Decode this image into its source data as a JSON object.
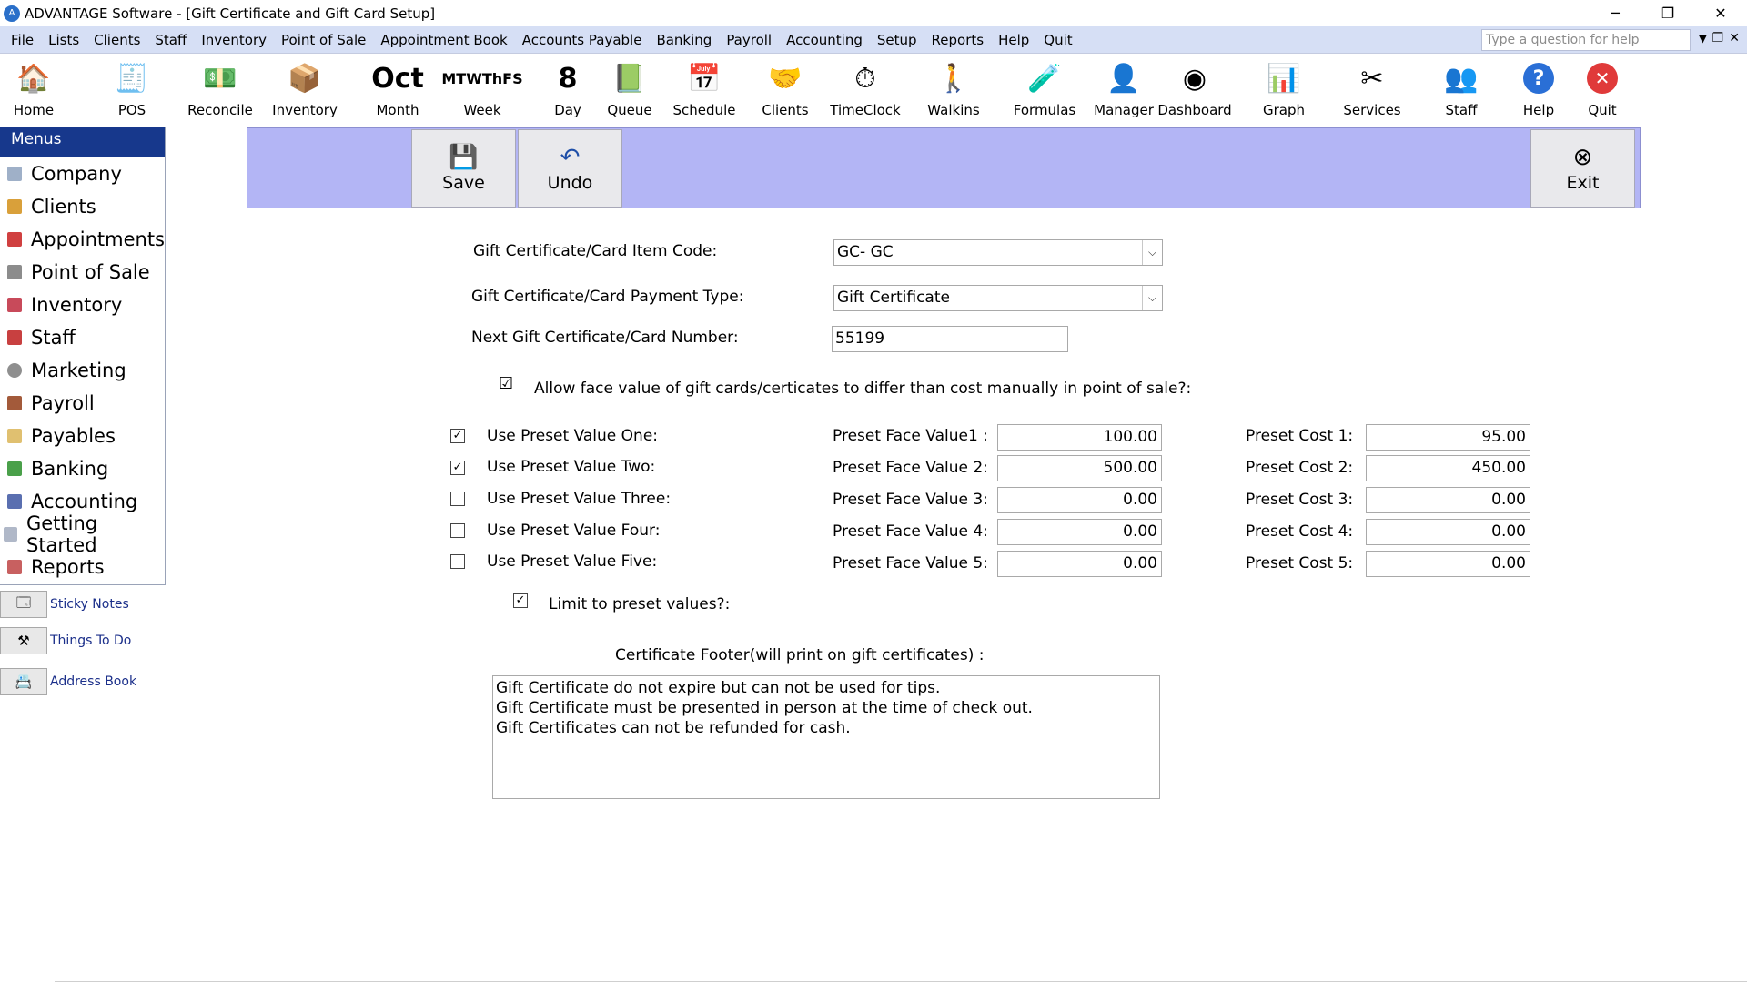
{
  "window": {
    "title": "ADVANTAGE Software - [Gift Certificate and Gift Card Setup]",
    "minimize": "─",
    "restore": "❐",
    "close": "✕"
  },
  "menubar": {
    "items": [
      "File",
      "Lists",
      "Clients",
      "Staff",
      "Inventory",
      "Point of Sale",
      "Appointment Book",
      "Accounts Payable",
      "Banking",
      "Payroll",
      "Accounting",
      "Setup",
      "Reports",
      "Help",
      "Quit"
    ],
    "help_placeholder": "Type a question for help"
  },
  "toolbar": [
    {
      "label": "Home",
      "icon": "house-icon",
      "glyph": "🏠"
    },
    {
      "label": "POS",
      "icon": "cash-register-icon",
      "glyph": "🧾"
    },
    {
      "label": "Reconcile",
      "icon": "money-icon",
      "glyph": "💵"
    },
    {
      "label": "Inventory",
      "icon": "box-icon",
      "glyph": "📦"
    },
    {
      "label": "Month",
      "icon": "calendar-month-icon",
      "glyph": "Oct"
    },
    {
      "label": "Week",
      "icon": "calendar-week-icon",
      "glyph": "MTWThFS"
    },
    {
      "label": "Day",
      "icon": "calendar-day-icon",
      "glyph": "8"
    },
    {
      "label": "Queue",
      "icon": "queue-icon",
      "glyph": "📗"
    },
    {
      "label": "Schedule",
      "icon": "schedule-icon",
      "glyph": "📅"
    },
    {
      "label": "Clients",
      "icon": "handshake-icon",
      "glyph": "🤝"
    },
    {
      "label": "TimeClock",
      "icon": "stopwatch-icon",
      "glyph": "⏱"
    },
    {
      "label": "Walkins",
      "icon": "walkin-icon",
      "glyph": "🚶"
    },
    {
      "label": "Formulas",
      "icon": "formula-icon",
      "glyph": "🧪"
    },
    {
      "label": "Manager",
      "icon": "manager-icon",
      "glyph": "👤"
    },
    {
      "label": "Dashboard",
      "icon": "gauge-icon",
      "glyph": "◉"
    },
    {
      "label": "Graph",
      "icon": "bar-graph-icon",
      "glyph": "📊"
    },
    {
      "label": "Services",
      "icon": "scissors-icon",
      "glyph": "✂"
    },
    {
      "label": "Staff",
      "icon": "staff-icon",
      "glyph": "👥"
    },
    {
      "label": "Help",
      "icon": "help-icon",
      "glyph": "?"
    },
    {
      "label": "Quit",
      "icon": "quit-icon",
      "glyph": "✕"
    }
  ],
  "sidebar": {
    "header": "Menus",
    "items": [
      "Company",
      "Clients",
      "Appointments",
      "Point of Sale",
      "Inventory",
      "Staff",
      "Marketing",
      "Payroll",
      "Payables",
      "Banking",
      "Accounting",
      "Getting Started",
      "Reports"
    ],
    "quick": [
      "Sticky Notes",
      "Things To Do",
      "Address Book"
    ]
  },
  "actions": {
    "save": "Save",
    "undo": "Undo",
    "exit": "Exit"
  },
  "form": {
    "item_code_label": "Gift Certificate/Card  Item Code:",
    "item_code_value": "GC- GC",
    "payment_type_label": "Gift Certificate/Card  Payment Type:",
    "payment_type_value": "Gift Certificate",
    "next_number_label": "Next Gift Certificate/Card Number:",
    "next_number_value": "55199",
    "allow_label": "Allow face value of gift cards/certicates to differ than cost manually in point of sale?:",
    "allow_checked": "☑",
    "presets": [
      {
        "use_label": "Use Preset Value One:",
        "checked": "✓",
        "face_label": "Preset Face Value1 :",
        "face": "100.00",
        "cost_label": "Preset Cost 1:",
        "cost": "95.00"
      },
      {
        "use_label": "Use Preset Value Two:",
        "checked": "✓",
        "face_label": "Preset Face Value 2:",
        "face": "500.00",
        "cost_label": "Preset Cost 2:",
        "cost": "450.00"
      },
      {
        "use_label": "Use Preset Value Three:",
        "checked": "",
        "face_label": "Preset Face Value 3:",
        "face": "0.00",
        "cost_label": "Preset Cost 3:",
        "cost": "0.00"
      },
      {
        "use_label": "Use Preset Value Four:",
        "checked": "",
        "face_label": "Preset Face Value 4:",
        "face": "0.00",
        "cost_label": "Preset Cost 4:",
        "cost": "0.00"
      },
      {
        "use_label": "Use Preset Value Five:",
        "checked": "",
        "face_label": "Preset Face Value 5:",
        "face": "0.00",
        "cost_label": "Preset Cost 5:",
        "cost": "0.00"
      }
    ],
    "limit_label": "Limit to preset values?:",
    "limit_checked": "✓",
    "footer_label": "Certificate Footer(will print on gift certificates) :",
    "footer_lines": [
      "Gift Certificate do not expire but can not be used for tips.",
      "Gift Certificate must be presented in person at the time of check out.",
      "Gift Certificates can not be refunded for cash."
    ]
  }
}
